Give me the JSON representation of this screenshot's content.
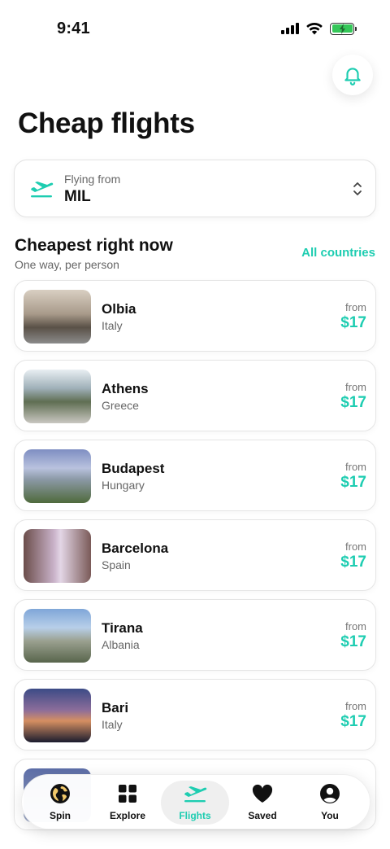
{
  "status_bar": {
    "time": "9:41"
  },
  "header": {
    "title": "Cheap flights",
    "bell_icon": "bell-icon"
  },
  "flying_from": {
    "label": "Flying from",
    "value": "MIL"
  },
  "section": {
    "title": "Cheapest right now",
    "subtitle": "One way, per person",
    "link": "All countries"
  },
  "destinations": [
    {
      "city": "Olbia",
      "country": "Italy",
      "from_label": "from",
      "price": "$17"
    },
    {
      "city": "Athens",
      "country": "Greece",
      "from_label": "from",
      "price": "$17"
    },
    {
      "city": "Budapest",
      "country": "Hungary",
      "from_label": "from",
      "price": "$17"
    },
    {
      "city": "Barcelona",
      "country": "Spain",
      "from_label": "from",
      "price": "$17"
    },
    {
      "city": "Tirana",
      "country": "Albania",
      "from_label": "from",
      "price": "$17"
    },
    {
      "city": "Bari",
      "country": "Italy",
      "from_label": "from",
      "price": "$17"
    }
  ],
  "tab_bar": {
    "tabs": [
      {
        "label": "Spin",
        "icon": "globe-icon",
        "active": false
      },
      {
        "label": "Explore",
        "icon": "grid-icon",
        "active": false
      },
      {
        "label": "Flights",
        "icon": "plane-icon",
        "active": true
      },
      {
        "label": "Saved",
        "icon": "heart-icon",
        "active": false
      },
      {
        "label": "You",
        "icon": "profile-icon",
        "active": false
      }
    ]
  },
  "colors": {
    "accent": "#1ecdb1",
    "text": "#111111",
    "muted": "#666666"
  }
}
